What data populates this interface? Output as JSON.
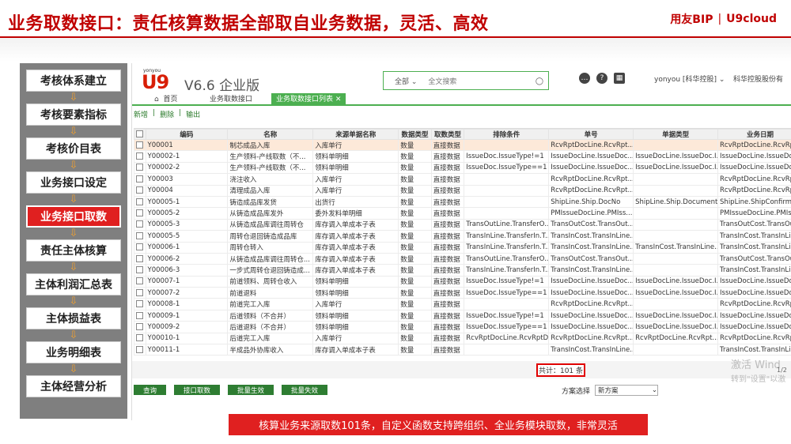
{
  "title": "业务取数接口：责任核算数据全部取自业务数据，灵活、高效",
  "brand": {
    "left": "用友BIP",
    "right": "U9cloud"
  },
  "flow_steps": [
    {
      "label": "考核体系建立",
      "active": false
    },
    {
      "label": "考核要素指标",
      "active": false
    },
    {
      "label": "考核价目表",
      "active": false
    },
    {
      "label": "业务接口设定",
      "active": false
    },
    {
      "label": "业务接口取数",
      "active": true
    },
    {
      "label": "责任主体核算",
      "active": false
    },
    {
      "label": "主体利润汇总表",
      "active": false
    },
    {
      "label": "主体损益表",
      "active": false
    },
    {
      "label": "业务明细表",
      "active": false
    },
    {
      "label": "主体经营分析",
      "active": false
    }
  ],
  "app": {
    "logo_small": "yonyou",
    "logo_big": "U9",
    "version": "V6.6 企业版",
    "search_scope": "全部",
    "search_placeholder": "全文搜索",
    "user": "yonyou [科华控股]",
    "org": "科华控股股份有",
    "tabs": {
      "home": "首页",
      "tab1": "业务取数接口",
      "tab2": "业务取数接口列表"
    },
    "toolbar": {
      "add": "新增",
      "delete": "删除",
      "export": "输出"
    }
  },
  "table": {
    "headers": [
      "编码",
      "名称",
      "来源单据名称",
      "数据类型",
      "取数类型",
      "排除条件",
      "单号",
      "单据类型",
      "业务日期"
    ],
    "rows": [
      [
        "Y00001",
        "制芯成品入库",
        "入库单行",
        "数量",
        "直接数据",
        "",
        "RcvRptDocLine.RcvRpt...",
        "",
        "RcvRptDocLine.RcvRpt..."
      ],
      [
        "Y00002-1",
        "生产领料-产线取数（不...",
        "领料单明细",
        "数量",
        "直接数据",
        "IssueDoc.IssueType!=1",
        "IssueDocLine.IssueDoc...",
        "IssueDocLine.IssueDoc.I...",
        "IssueDocLine.IssueDoc..."
      ],
      [
        "Y00002-2",
        "生产领料-产线取数（不...",
        "领料单明细",
        "数量",
        "直接数据",
        "IssueDoc.IssueType==1",
        "IssueDocLine.IssueDoc...",
        "IssueDocLine.IssueDoc.I...",
        "IssueDocLine.IssueDoc..."
      ],
      [
        "Y00003",
        "浇注收入",
        "入库单行",
        "数量",
        "直接数据",
        "",
        "RcvRptDocLine.RcvRpt...",
        "",
        "RcvRptDocLine.RcvRpt..."
      ],
      [
        "Y00004",
        "清理成品入库",
        "入库单行",
        "数量",
        "直接数据",
        "",
        "RcvRptDocLine.RcvRpt...",
        "",
        "RcvRptDocLine.RcvRpt..."
      ],
      [
        "Y00005-1",
        "铸造成品库发货",
        "出货行",
        "数量",
        "直接数据",
        "",
        "ShipLine.Ship.DocNo",
        "ShipLine.Ship.Document...",
        "ShipLine.ShipConfirmDate"
      ],
      [
        "Y00005-2",
        "从铸造成品库发外",
        "委外发料单明细",
        "数量",
        "直接数据",
        "",
        "PMIssueDocLine.PMIss...",
        "",
        "PMIssueDocLine.PMIss..."
      ],
      [
        "Y00005-3",
        "从铸造成品库调往周转仓",
        "库存调入单成本子表",
        "数量",
        "直接数据",
        "TransOutLine.TransferO...",
        "TransOutCost.TransOut...",
        "",
        "TransOutCost.TransOut..."
      ],
      [
        "Y00005-5",
        "周转仓退回铸造成品库",
        "库存调入单成本子表",
        "数量",
        "直接数据",
        "TransInLine.TransferIn.T...",
        "TransInCost.TransInLine...",
        "",
        "TransInCost.TransInLine..."
      ],
      [
        "Y00006-1",
        "周转仓转入",
        "库存调入单成本子表",
        "数量",
        "直接数据",
        "TransInLine.TransferIn.T...",
        "TransInCost.TransInLine...",
        "TransInCost.TransInLine...",
        "TransInCost.TransInLine..."
      ],
      [
        "Y00006-2",
        "从铸造成品库调往周转仓...",
        "库存调入单成本子表",
        "数量",
        "直接数据",
        "TransOutLine.TransferO...",
        "TransOutCost.TransOut...",
        "",
        "TransOutCost.TransOut..."
      ],
      [
        "Y00006-3",
        "一步式周转仓退回铸造成...",
        "库存调入单成本子表",
        "数量",
        "直接数据",
        "TransInLine.TransferIn.T...",
        "TransInCost.TransInLine...",
        "",
        "TransInCost.TransInLine..."
      ],
      [
        "Y00007-1",
        "前道领料、周转仓收入",
        "领料单明细",
        "数量",
        "直接数据",
        "IssueDoc.IssueType!=1",
        "IssueDocLine.IssueDoc...",
        "IssueDocLine.IssueDoc.I...",
        "IssueDocLine.IssueDoc..."
      ],
      [
        "Y00007-2",
        "前道退料",
        "领料单明细",
        "数量",
        "直接数据",
        "IssueDoc.IssueType==1",
        "IssueDocLine.IssueDoc...",
        "IssueDocLine.IssueDoc.I...",
        "IssueDocLine.IssueDoc..."
      ],
      [
        "Y00008-1",
        "前道完工入库",
        "入库单行",
        "数量",
        "直接数据",
        "",
        "RcvRptDocLine.RcvRpt...",
        "",
        "RcvRptDocLine.RcvRpt..."
      ],
      [
        "Y00009-1",
        "后道领料（不合并）",
        "领料单明细",
        "数量",
        "直接数据",
        "IssueDoc.IssueType!=1",
        "IssueDocLine.IssueDoc...",
        "IssueDocLine.IssueDoc.I...",
        "IssueDocLine.IssueDoc..."
      ],
      [
        "Y00009-2",
        "后道退料（不合并）",
        "领料单明细",
        "数量",
        "直接数据",
        "IssueDoc.IssueType==1",
        "IssueDocLine.IssueDoc...",
        "IssueDocLine.IssueDoc.I...",
        "IssueDocLine.IssueDoc..."
      ],
      [
        "Y00010-1",
        "后道完工入库",
        "入库单行",
        "数量",
        "直接数据",
        "RcvRptDocLine.RcvRptDocT...",
        "RcvRptDocLine.RcvRpt...",
        "RcvRptDocLine.RcvRpt...",
        "RcvRptDocLine.RcvRpt..."
      ],
      [
        "Y00011-1",
        "半成品外协库收入",
        "库存调入单成本子表",
        "数量",
        "直接数据",
        "",
        "TransInCost.TransInLine...",
        "",
        "TransInCost.TransInLine..."
      ]
    ],
    "total": "共计：101 条"
  },
  "watermark": {
    "line1": "激活 Wind",
    "line2": "转到\"设置\"以激"
  },
  "page_indicator": "1/2",
  "buttons": {
    "query": "查询",
    "fetch": "接口取数",
    "batch_effect": "批量生效",
    "batch_invalid": "批量失效"
  },
  "scheme": {
    "label": "方案选择",
    "value": "新方案"
  },
  "caption": "核算业务来源取数101条，自定义函数支持跨组织、全业务模块取数，非常灵活"
}
